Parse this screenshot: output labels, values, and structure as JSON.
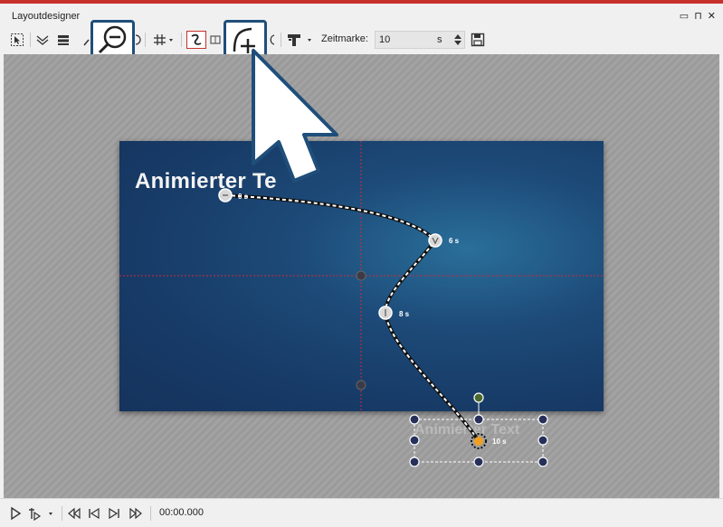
{
  "window": {
    "title": "Layoutdesigner",
    "controls": [
      "▭",
      "⊓",
      "✕"
    ]
  },
  "toolbar": {
    "zeitmarke_label": "Zeitmarke:",
    "zeitmarke_value": "10",
    "zeitmarke_unit": "s",
    "icons": [
      "select-icon",
      "layers-icon",
      "align-icon",
      "zoom-out-icon",
      "grid-icon",
      "curve-icon",
      "add-keyframe-icon",
      "text-tool-icon",
      "save-icon"
    ]
  },
  "stage": {
    "title_text": "Animierter Te",
    "ghost_text": "Animierter Text",
    "keyframes": [
      {
        "label": "0 s"
      },
      {
        "label": "6 s"
      },
      {
        "label": "8 s"
      },
      {
        "label": "10 s"
      }
    ],
    "colors": {
      "stage_dark": "#15335d",
      "stage_light": "#2a6f9a",
      "highlight": "#1f4e7a",
      "guide": "#d0283c",
      "handle_active": "#f0a020"
    }
  },
  "statusbar": {
    "time": "00:00.000"
  }
}
